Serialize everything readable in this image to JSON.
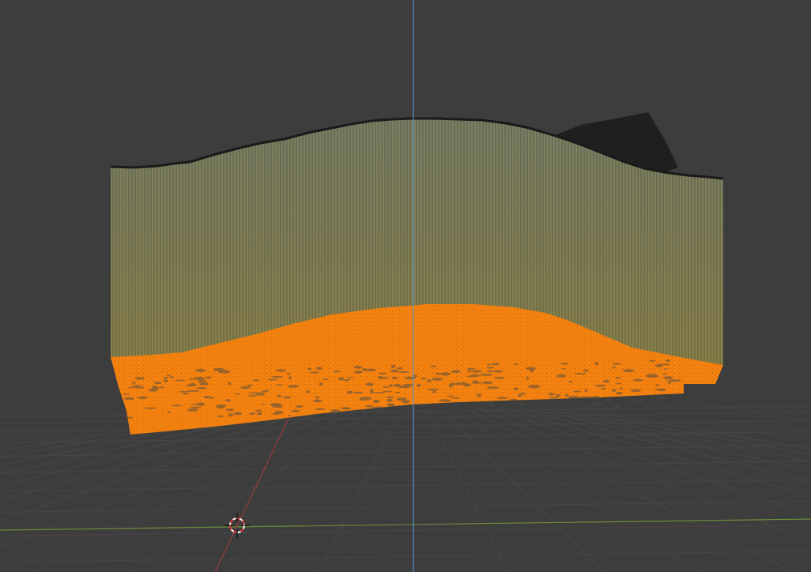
{
  "app": {
    "view": "3d-viewport",
    "background_color": "#3d3d3d",
    "grid_color": "#474747",
    "axis_x_color": "#6b8c3c",
    "axis_y_color": "#9b3b3b",
    "axis_z_color": "#5b8fc9"
  },
  "scene": {
    "selected_mesh": {
      "name_shown": "",
      "selection_color": "#f5810e",
      "state": "selected-vertices"
    },
    "extrusion_lines_color": "#7a7a4a",
    "top_edge_color": "#1a1a1a",
    "dark_object_color": "#1f1f1f"
  },
  "gizmos": {
    "cursor_icon": "3d-cursor-icon"
  }
}
